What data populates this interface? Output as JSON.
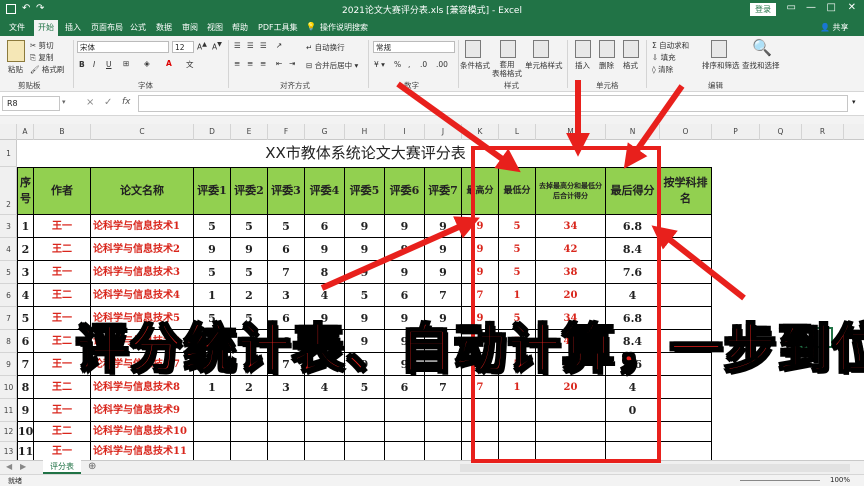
{
  "window": {
    "title": "2021论文大赛评分表.xls  [兼容模式]  -  Excel",
    "login": "登录",
    "share": "共享"
  },
  "tabs": [
    "文件",
    "开始",
    "插入",
    "页面布局",
    "公式",
    "数据",
    "审阅",
    "视图",
    "帮助",
    "PDF工具集",
    "操作说明搜索"
  ],
  "ribbon": {
    "paste": "粘贴",
    "cut": "剪切",
    "copy": "复制",
    "format_painter": "格式刷",
    "clipboard": "剪贴板",
    "font_name": "宋体",
    "font_size": "12",
    "font_group": "字体",
    "wrap": "自动换行",
    "merge": "合并后居中",
    "align_group": "对齐方式",
    "num_format": "常规",
    "num_group": "数字",
    "cond": "条件格式",
    "table": "套用\n表格格式",
    "cell_style": "单元格样式",
    "style_group": "样式",
    "insert": "插入",
    "delete": "删除",
    "format": "格式",
    "cells_group": "单元格",
    "autosum": "自动求和",
    "fill": "填充",
    "clear": "清除",
    "sort": "排序和筛选",
    "find": "查找和选择",
    "edit_group": "编辑"
  },
  "name_box": "R8",
  "formula_icons": [
    "×",
    "✓",
    "fx"
  ],
  "columns": [
    "A",
    "B",
    "C",
    "D",
    "E",
    "F",
    "G",
    "H",
    "I",
    "J",
    "K",
    "L",
    "M",
    "N",
    "O",
    "P",
    "Q",
    "R"
  ],
  "rows": [
    "1",
    "2",
    "3",
    "4",
    "5",
    "6",
    "7",
    "8",
    "9",
    "10",
    "11",
    "12",
    "13"
  ],
  "sheet_title": "XX市教体系统论文大赛评分表",
  "headers": [
    "序号",
    "作者",
    "论文名称",
    "评委1",
    "评委2",
    "评委3",
    "评委4",
    "评委5",
    "评委6",
    "评委7",
    "最高分",
    "最低分",
    "去掉最高分和最低分后合计得分",
    "最后得分",
    "按学科排名"
  ],
  "data_rows": [
    {
      "no": "1",
      "author": "王一",
      "title": "论科学与信息技术1",
      "s": [
        "5",
        "5",
        "5",
        "6",
        "9",
        "9",
        "9"
      ],
      "max": "9",
      "min": "5",
      "sum": "34",
      "final": "6.8"
    },
    {
      "no": "2",
      "author": "王二",
      "title": "论科学与信息技术2",
      "s": [
        "9",
        "9",
        "6",
        "9",
        "9",
        "9",
        "9"
      ],
      "max": "9",
      "min": "5",
      "sum": "42",
      "final": "8.4"
    },
    {
      "no": "3",
      "author": "王一",
      "title": "论科学与信息技术3",
      "s": [
        "5",
        "5",
        "7",
        "8",
        "9",
        "9",
        "9"
      ],
      "max": "9",
      "min": "5",
      "sum": "38",
      "final": "7.6"
    },
    {
      "no": "4",
      "author": "王二",
      "title": "论科学与信息技术4",
      "s": [
        "1",
        "2",
        "3",
        "4",
        "5",
        "6",
        "7"
      ],
      "max": "7",
      "min": "1",
      "sum": "20",
      "final": "4"
    },
    {
      "no": "5",
      "author": "王一",
      "title": "论科学与信息技术5",
      "s": [
        "5",
        "5",
        "6",
        "9",
        "9",
        "9",
        "9"
      ],
      "max": "9",
      "min": "5",
      "sum": "34",
      "final": "6.8"
    },
    {
      "no": "6",
      "author": "王二",
      "title": "论科学与信息技术6",
      "s": [
        "9",
        "9",
        "6",
        "9",
        "9",
        "9",
        "9"
      ],
      "max": "9",
      "min": "5",
      "sum": "42",
      "final": "8.4"
    },
    {
      "no": "7",
      "author": "王一",
      "title": "论科学与信息技术7",
      "s": [
        "5",
        "5",
        "7",
        "8",
        "9",
        "9",
        "9"
      ],
      "max": "9",
      "min": "5",
      "sum": "38",
      "final": "7.6"
    },
    {
      "no": "8",
      "author": "王二",
      "title": "论科学与信息技术8",
      "s": [
        "1",
        "2",
        "3",
        "4",
        "5",
        "6",
        "7"
      ],
      "max": "7",
      "min": "1",
      "sum": "20",
      "final": "4"
    },
    {
      "no": "9",
      "author": "王一",
      "title": "论科学与信息技术9",
      "s": [
        "",
        "",
        "",
        "",
        "",
        "",
        ""
      ],
      "max": "",
      "min": "",
      "sum": "",
      "final": "0"
    },
    {
      "no": "10",
      "author": "王二",
      "title": "论科学与信息技术10",
      "s": [
        "",
        "",
        "",
        "",
        "",
        "",
        ""
      ],
      "max": "",
      "min": "",
      "sum": "",
      "final": ""
    },
    {
      "no": "11",
      "author": "王一",
      "title": "论科学与信息技术11",
      "s": [
        "",
        "",
        "",
        "",
        "",
        "",
        ""
      ],
      "max": "",
      "min": "",
      "sum": "",
      "final": ""
    }
  ],
  "sheet_tab": "评分表",
  "status": {
    "ready": "就绪",
    "zoom": "100%"
  },
  "overlay_caption": "评分统计表、自动计算，一步到位",
  "colors": {
    "excel_green": "#217346",
    "header_fill": "#92d050",
    "annotation_red": "#e8201c",
    "cell_red": "#d9261c"
  }
}
